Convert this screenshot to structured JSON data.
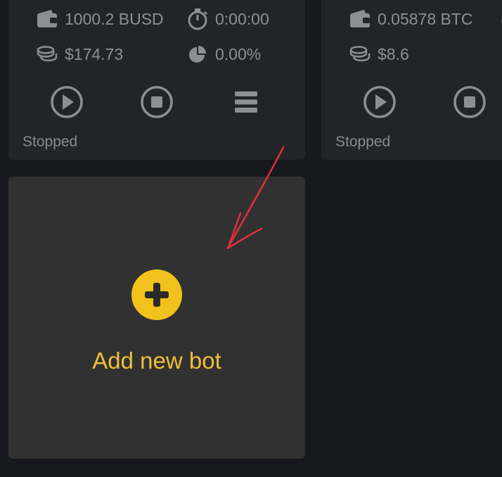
{
  "bots": [
    {
      "balance": "1000.2 BUSD",
      "time": "0:00:00",
      "value": "$174.73",
      "percent": "0.00%",
      "status": "Stopped"
    },
    {
      "balance": "0.05878 BTC",
      "value": "$8.6",
      "status": "Stopped"
    }
  ],
  "add_bot": {
    "label": "Add new bot"
  },
  "colors": {
    "background": "#16181d",
    "card": "#232427",
    "add_card": "#313131",
    "accent_yellow": "#f3c11b",
    "annotation_arrow": "#e0313a"
  },
  "icons": [
    "wallet-icon",
    "stopwatch-icon",
    "coins-icon",
    "pie-chart-icon",
    "play-icon",
    "stop-icon",
    "menu-icon",
    "plus-icon",
    "arrow-annotation"
  ]
}
